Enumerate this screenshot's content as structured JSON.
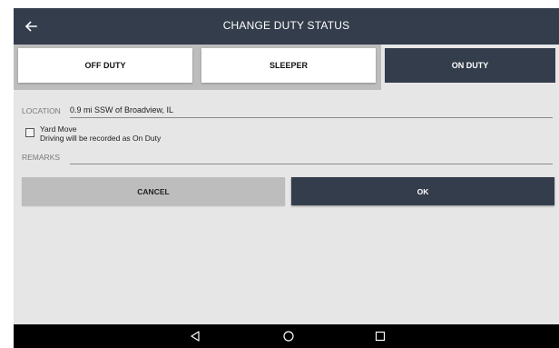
{
  "header": {
    "title": "CHANGE DUTY STATUS",
    "back_icon": "arrow-left-icon"
  },
  "duty_status": {
    "options": [
      {
        "label": "OFF DUTY",
        "selected": false
      },
      {
        "label": "SLEEPER",
        "selected": false
      },
      {
        "label": "ON DUTY",
        "selected": true
      }
    ]
  },
  "form": {
    "location_label": "LOCATION",
    "location_value": "0.9 mi SSW of Broadview, IL",
    "yard_move_label": "Yard Move",
    "yard_move_note": "Driving will be recorded as On Duty",
    "yard_move_checked": false,
    "remarks_label": "REMARKS",
    "remarks_value": ""
  },
  "actions": {
    "cancel_label": "CANCEL",
    "ok_label": "OK"
  },
  "nav_bar": {
    "icons": [
      "nav-back-icon",
      "nav-home-icon",
      "nav-recent-apps-icon"
    ]
  },
  "colors": {
    "primary_dark": "#333d4c",
    "background": "#e6e6e6",
    "button_gray": "#bdbdbd"
  }
}
